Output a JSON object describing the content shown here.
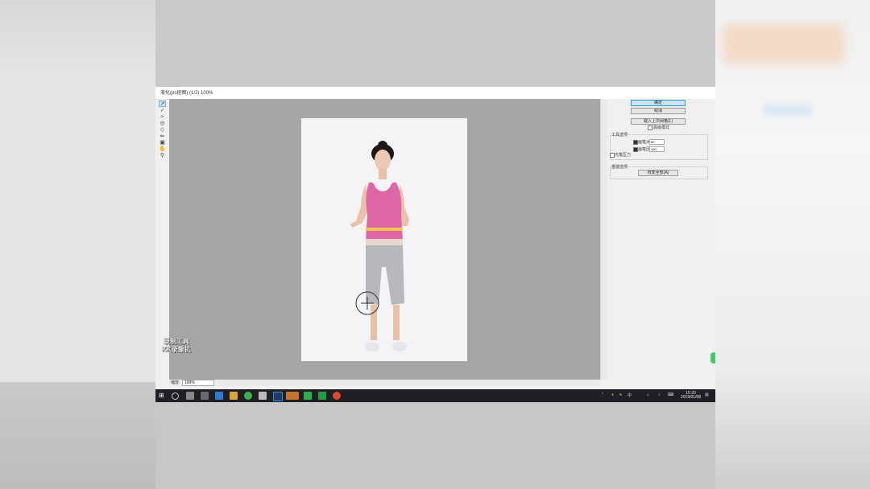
{
  "window": {
    "title": "液化(ps抠图) (1/2) 100%"
  },
  "tools": [
    "warp-tool",
    "reconstruct-tool",
    "smooth-tool",
    "pucker-tool",
    "bloat-tool",
    "push-left-tool",
    "freeze-mask-tool",
    "hand-tool",
    "zoom-tool"
  ],
  "panel": {
    "ok_label": "确定",
    "cancel_label": "取消",
    "advanced_mode_label": "载入上次网格(L)",
    "advanced_checkbox_label": "高级模式",
    "tool_options_heading": "工具选项",
    "brush_size_label": "画笔大小:",
    "brush_size_value": "80",
    "brush_pressure_label": "画笔压力:",
    "brush_pressure_value": "100",
    "stylus_label": "光笔压力",
    "reconstruct_heading": "重建选项",
    "reconstruct_button_label": "恢复全部(A)"
  },
  "status": {
    "zoom_label": "缩放",
    "zoom_value": "100%"
  },
  "watermark": {
    "line1": "录制工具",
    "line2": "KK录像机"
  },
  "taskbar": {
    "clock_time": "15:20",
    "clock_date": "2019/01/08",
    "tray_label": "中"
  },
  "colors": {
    "canvas_bg": "#a4a7a3",
    "accent": "#3a8fd1",
    "tank_top": "#df66a4",
    "pants": "#b7b8bc",
    "taskbar": "#1f1f25"
  }
}
